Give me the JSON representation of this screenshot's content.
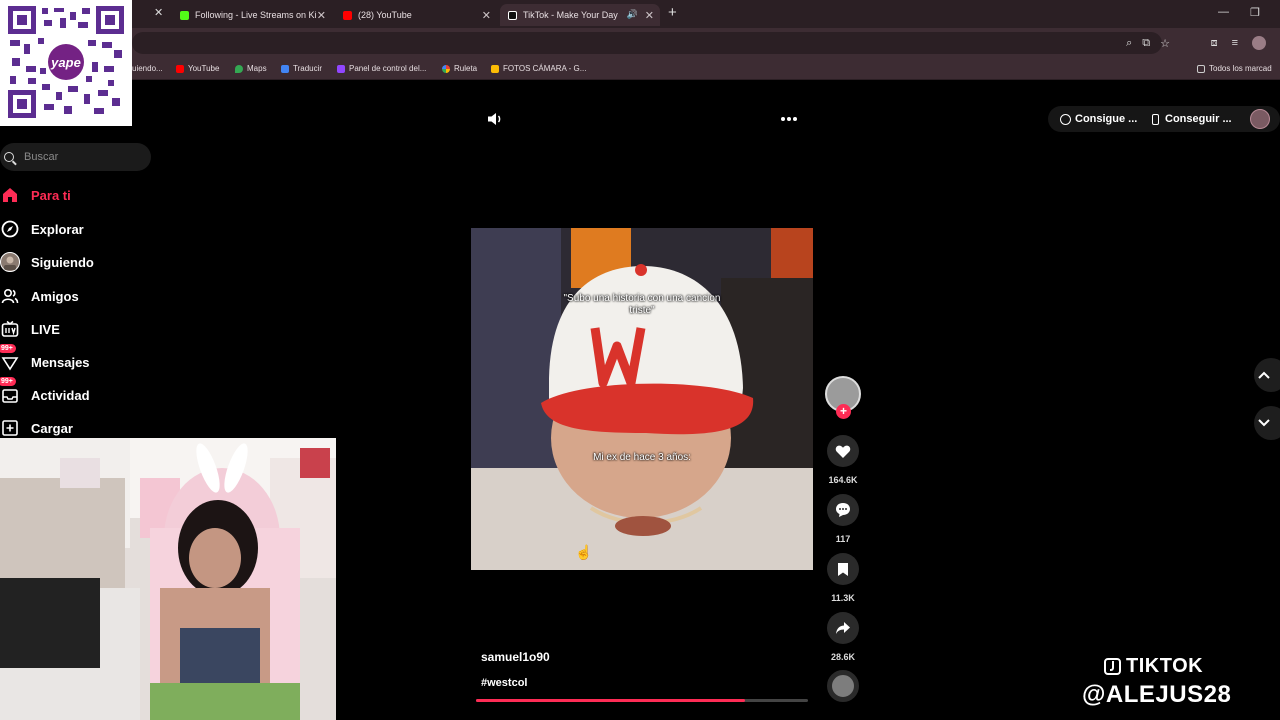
{
  "browser": {
    "tabs": [
      {
        "label": "Following - Live Streams on Ki",
        "icon": "kick-icon",
        "color": "#53fc18"
      },
      {
        "label": "(28) YouTube",
        "icon": "youtube-icon",
        "color": "#ff0000"
      },
      {
        "label": "TikTok - Make Your Day",
        "icon": "tiktok-icon",
        "color": "#ffffff"
      }
    ],
    "bookmarks": [
      {
        "label": "uiendo..."
      },
      {
        "label": "YouTube"
      },
      {
        "label": "Maps"
      },
      {
        "label": "Traducir"
      },
      {
        "label": "Panel de control del..."
      },
      {
        "label": "Ruleta"
      },
      {
        "label": "FOTOS CÁMARA - G..."
      },
      {
        "label": "Todos los marcad"
      }
    ]
  },
  "overlay": {
    "qr_brand": "yape"
  },
  "sidebar": {
    "search_placeholder": "Buscar",
    "items": [
      {
        "label": "Para ti",
        "icon": "home-icon"
      },
      {
        "label": "Explorar",
        "icon": "compass-icon"
      },
      {
        "label": "Siguiendo",
        "icon": "following-avatar-icon"
      },
      {
        "label": "Amigos",
        "icon": "friends-icon"
      },
      {
        "label": "LIVE",
        "icon": "live-icon"
      },
      {
        "label": "Mensajes",
        "icon": "messages-icon",
        "badge": "99+"
      },
      {
        "label": "Actividad",
        "icon": "inbox-icon",
        "badge": "99+"
      },
      {
        "label": "Cargar",
        "icon": "upload-icon"
      }
    ]
  },
  "topbar": {
    "get_coins": "Consigue ...",
    "get_app": "Conseguir ..."
  },
  "video": {
    "caption_top": "\"Subo una historia con una cancion triste\"",
    "caption_bottom": "Mi ex de hace 3 años:",
    "author": "samuel1o90",
    "hashtag": "#westcol",
    "progress": 0.81
  },
  "actions": {
    "likes": "164.6K",
    "comments": "117",
    "saves": "11.3K",
    "shares": "28.6K"
  },
  "watermark": {
    "line1": "TIKTOK",
    "line2": "@ALEJUS28"
  },
  "colors": {
    "accent": "#fe2c55",
    "chrome": "#3d2c33"
  }
}
